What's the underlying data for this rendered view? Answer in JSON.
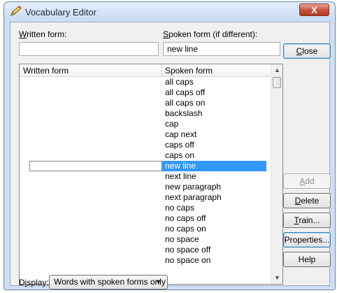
{
  "window": {
    "title": "Vocabulary Editor",
    "close_glyph": "X"
  },
  "form": {
    "written_label": "Written form:",
    "written_value": "",
    "spoken_label": "Spoken form (if different):",
    "spoken_value": "new line"
  },
  "list": {
    "headers": [
      "Written form",
      "Spoken form"
    ],
    "items": [
      "all caps",
      "all caps off",
      "all caps on",
      "backslash",
      "cap",
      "cap next",
      "caps off",
      "caps on",
      "new line",
      "next line",
      "new paragraph",
      "next paragraph",
      "no caps",
      "no caps off",
      "no caps on",
      "no space",
      "no space off",
      "no space on"
    ],
    "selected_index": 8
  },
  "buttons": {
    "close": "Close",
    "add": "Add",
    "delete": "Delete",
    "train": "Train...",
    "properties": "Properties...",
    "help": "Help"
  },
  "display": {
    "label": "Display:",
    "value": "Words with spoken forms only"
  },
  "colors": {
    "selection": "#3399ff",
    "title_close": "#c7523a"
  },
  "icons": {
    "title": "pencil-icon",
    "scroll_up": "triangle-up",
    "scroll_down": "triangle-down",
    "dropdown": "triangle-down"
  }
}
